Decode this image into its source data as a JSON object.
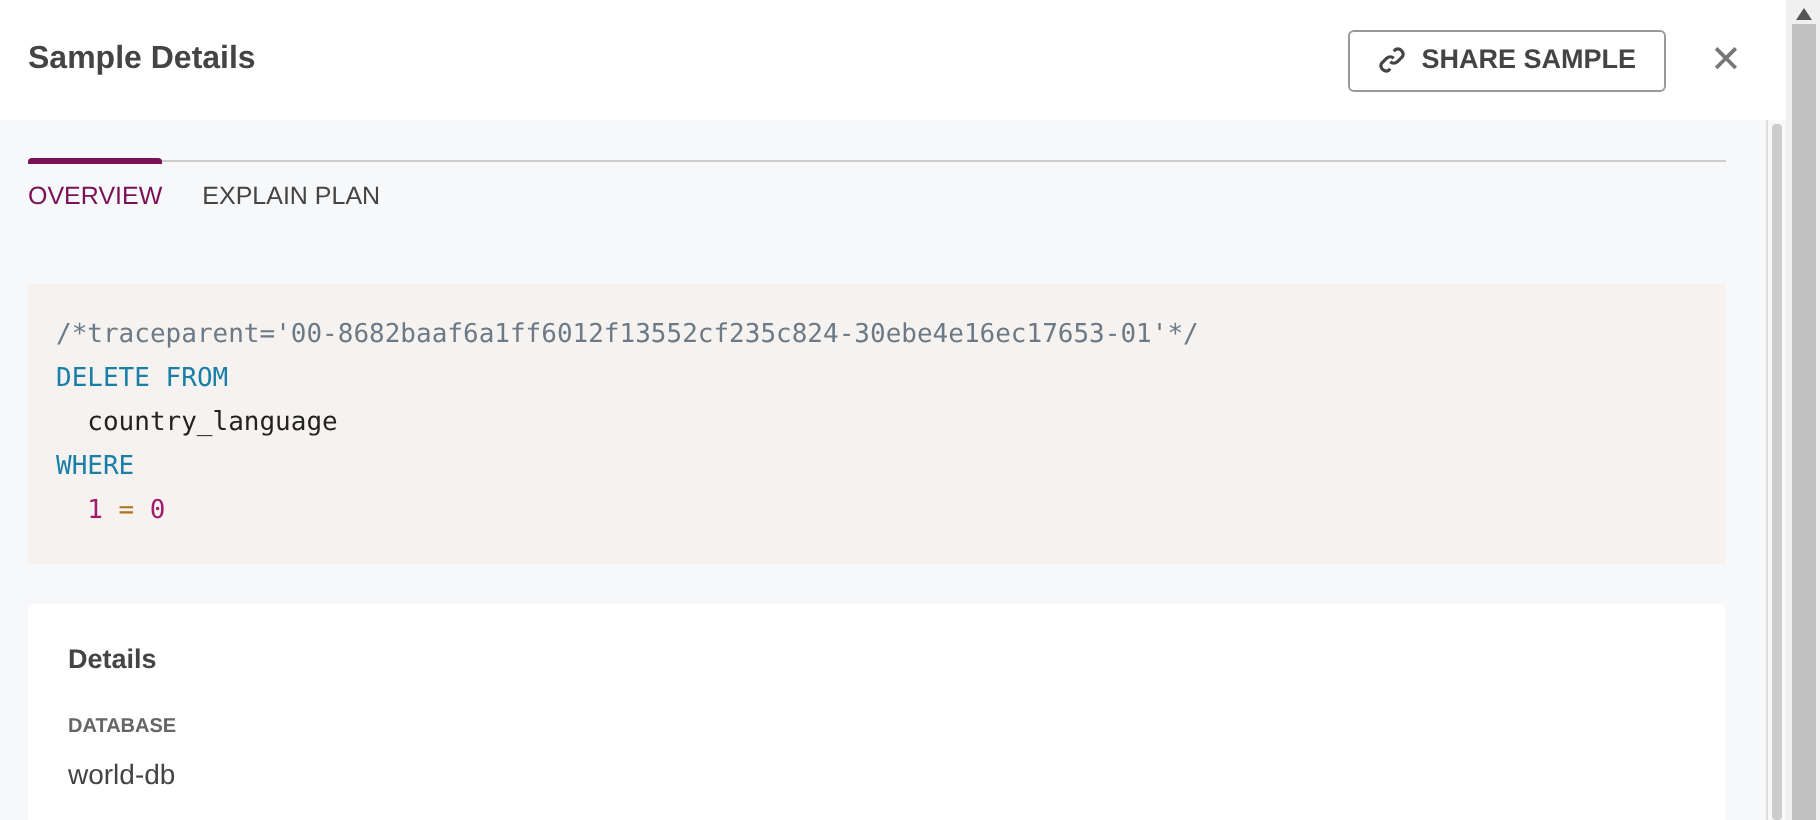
{
  "window": {
    "title": "Sample Details"
  },
  "actions": {
    "share_button": "SHARE SAMPLE",
    "close": "✕"
  },
  "tabs": [
    {
      "label": "OVERVIEW",
      "selected": true
    },
    {
      "label": "EXPLAIN PLAN",
      "selected": false
    }
  ],
  "query": {
    "lines": [
      [
        {
          "kind": "comment",
          "text": "/*traceparent='00-8682baaf6a1ff6012f13552cf235c824-30ebe4e16ec17653-01'*/"
        }
      ],
      [
        {
          "kind": "keyword",
          "text": "DELETE FROM"
        }
      ],
      {
        "indented": true,
        "tokens": [
          {
            "kind": "plain",
            "text": "country_language"
          }
        ]
      },
      [
        {
          "kind": "keyword",
          "text": "WHERE"
        }
      ],
      {
        "indented": true,
        "tokens": [
          {
            "kind": "number",
            "text": "1"
          },
          {
            "kind": "operator",
            "text": "="
          },
          {
            "kind": "number",
            "text": "0"
          }
        ]
      }
    ]
  },
  "details": {
    "title": "Details",
    "fields": [
      {
        "label": "DATABASE",
        "value": "world-db"
      }
    ]
  }
}
